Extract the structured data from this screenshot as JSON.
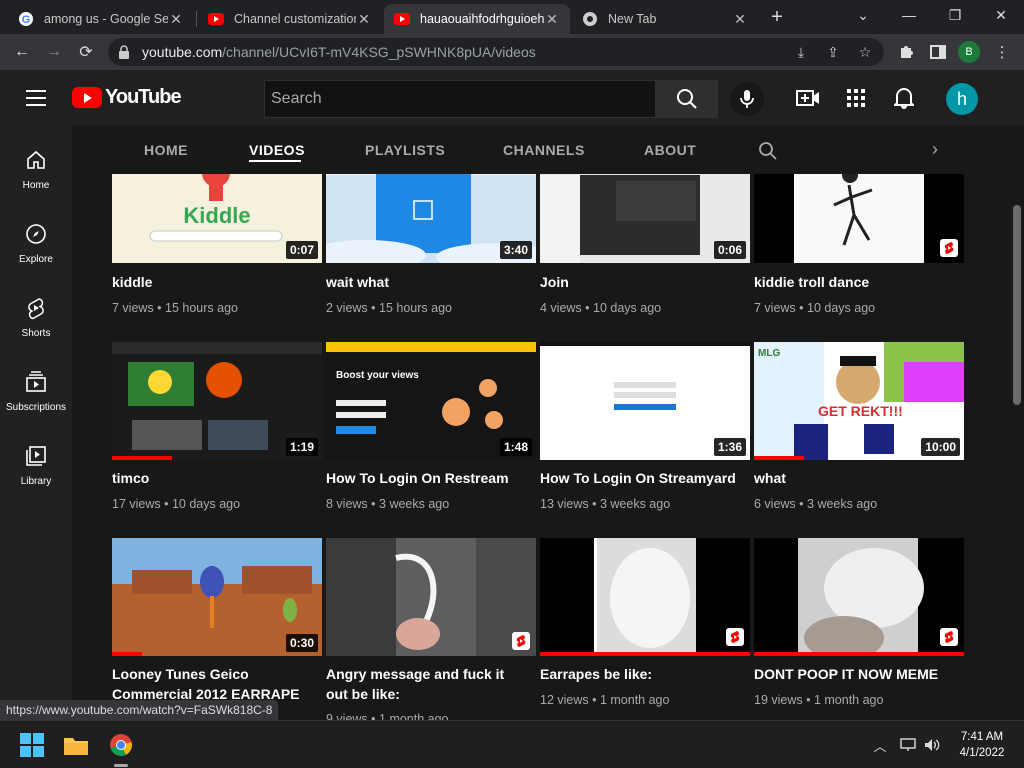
{
  "browser": {
    "tabs": [
      {
        "title": "among us - Google Search",
        "favicon": "google-icon"
      },
      {
        "title": "Channel customization - YouTube Studio",
        "favicon": "youtube-icon"
      },
      {
        "title": "hauaouaihfodrhguioehg - YouTube",
        "favicon": "youtube-icon"
      },
      {
        "title": "New Tab",
        "favicon": "chrome-icon"
      }
    ],
    "url_host": "youtube.com",
    "url_path": "/channel/UCvI6T-mV4KSG_pSWHNK8pUA/videos",
    "profile_initial": "B"
  },
  "header": {
    "logo_text": "YouTube",
    "search_placeholder": "Search",
    "avatar_initial": "h"
  },
  "sidebar": {
    "items": [
      {
        "label": "Home",
        "icon": "home-icon"
      },
      {
        "label": "Explore",
        "icon": "compass-icon"
      },
      {
        "label": "Shorts",
        "icon": "shorts-icon"
      },
      {
        "label": "Subscriptions",
        "icon": "subscriptions-icon"
      },
      {
        "label": "Library",
        "icon": "library-icon"
      }
    ]
  },
  "channel_tabs": [
    "HOME",
    "VIDEOS",
    "PLAYLISTS",
    "CHANNELS",
    "ABOUT"
  ],
  "active_tab": "VIDEOS",
  "videos": [
    {
      "title": "kiddle",
      "views": "7 views",
      "age": "15 hours ago",
      "duration": "0:07"
    },
    {
      "title": "wait what",
      "views": "2 views",
      "age": "15 hours ago",
      "duration": "3:40"
    },
    {
      "title": "Join",
      "views": "4 views",
      "age": "10 days ago",
      "duration": "0:06"
    },
    {
      "title": "kiddie troll dance",
      "views": "7 views",
      "age": "10 days ago",
      "duration": ""
    },
    {
      "title": "timco",
      "views": "17 views",
      "age": "10 days ago",
      "duration": "1:19"
    },
    {
      "title": "How To Login On Restream",
      "views": "8 views",
      "age": "3 weeks ago",
      "duration": "1:48"
    },
    {
      "title": "How To Login On Streamyard",
      "views": "13 views",
      "age": "3 weeks ago",
      "duration": "1:36"
    },
    {
      "title": "what",
      "views": "6 views",
      "age": "3 weeks ago",
      "duration": "10:00"
    },
    {
      "title": "Looney Tunes Geico Commercial 2012 EARRAPE",
      "views": "",
      "age": "",
      "duration": "0:30"
    },
    {
      "title": "Angry message and fuck it out be like:",
      "views": "9 views",
      "age": "1 month ago",
      "duration": ""
    },
    {
      "title": "Earrapes be like:",
      "views": "12 views",
      "age": "1 month ago",
      "duration": ""
    },
    {
      "title": "DONT POOP IT NOW MEME",
      "views": "19 views",
      "age": "1 month ago",
      "duration": ""
    }
  ],
  "thumb_texts": {
    "kiddle_brand": "Kiddle",
    "restream_headline": "Boost your views",
    "what_caption": "GET REKT!!!",
    "what_brand": "MLG"
  },
  "status_url": "https://www.youtube.com/watch?v=FaSWk818C-8",
  "taskbar": {
    "time": "7:41 AM",
    "date": "4/1/2022"
  },
  "colors": {
    "accent": "#ff0000",
    "background": "#181818",
    "header": "#202020"
  }
}
